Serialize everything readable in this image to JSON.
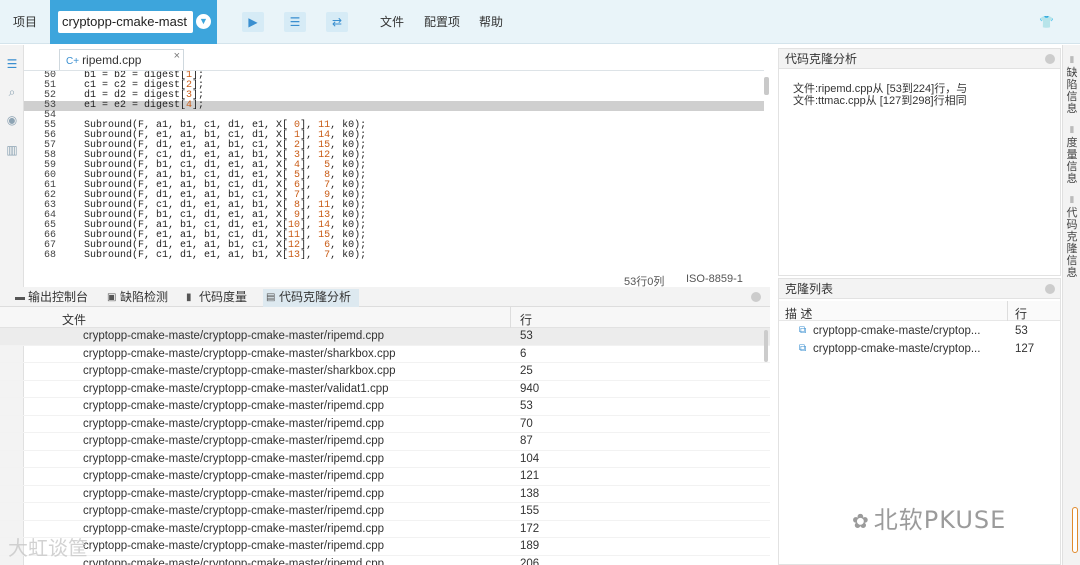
{
  "topbar": {
    "project_label": "项目",
    "project_name": "cryptopp-cmake-mast",
    "menus": [
      "文件",
      "配置项",
      "帮助"
    ]
  },
  "editor": {
    "tab_name": "ripemd.cpp",
    "highlight_line": 53,
    "lines": [
      {
        "n": "50",
        "code": "    b1 = b2 = digest[1];"
      },
      {
        "n": "51",
        "code": "    c1 = c2 = digest[2];"
      },
      {
        "n": "52",
        "code": "    d1 = d2 = digest[3];"
      },
      {
        "n": "53",
        "code": "    e1 = e2 = digest[4];"
      },
      {
        "n": "54",
        "code": ""
      },
      {
        "n": "55",
        "code": "    Subround(F, a1, b1, c1, d1, e1, X[ 0], 11, k0);"
      },
      {
        "n": "56",
        "code": "    Subround(F, e1, a1, b1, c1, d1, X[ 1], 14, k0);"
      },
      {
        "n": "57",
        "code": "    Subround(F, d1, e1, a1, b1, c1, X[ 2], 15, k0);"
      },
      {
        "n": "58",
        "code": "    Subround(F, c1, d1, e1, a1, b1, X[ 3], 12, k0);"
      },
      {
        "n": "59",
        "code": "    Subround(F, b1, c1, d1, e1, a1, X[ 4],  5, k0);"
      },
      {
        "n": "60",
        "code": "    Subround(F, a1, b1, c1, d1, e1, X[ 5],  8, k0);"
      },
      {
        "n": "61",
        "code": "    Subround(F, e1, a1, b1, c1, d1, X[ 6],  7, k0);"
      },
      {
        "n": "62",
        "code": "    Subround(F, d1, e1, a1, b1, c1, X[ 7],  9, k0);"
      },
      {
        "n": "63",
        "code": "    Subround(F, c1, d1, e1, a1, b1, X[ 8], 11, k0);"
      },
      {
        "n": "64",
        "code": "    Subround(F, b1, c1, d1, e1, a1, X[ 9], 13, k0);"
      },
      {
        "n": "65",
        "code": "    Subround(F, a1, b1, c1, d1, e1, X[10], 14, k0);"
      },
      {
        "n": "66",
        "code": "    Subround(F, e1, a1, b1, c1, d1, X[11], 15, k0);"
      },
      {
        "n": "67",
        "code": "    Subround(F, d1, e1, a1, b1, c1, X[12],  6, k0);"
      },
      {
        "n": "68",
        "code": "    Subround(F, c1, d1, e1, a1, b1, X[13],  7, k0);"
      }
    ],
    "status_position": "53行0列",
    "status_encoding": "ISO-8859-1"
  },
  "bottom_tabs": [
    "输出控制台",
    "缺陷检测",
    "代码度量",
    "代码克隆分析"
  ],
  "file_table": {
    "headers": [
      "文件",
      "行"
    ],
    "rows": [
      {
        "file": "cryptopp-cmake-maste/cryptopp-cmake-master/ripemd.cpp",
        "line": "53"
      },
      {
        "file": "cryptopp-cmake-maste/cryptopp-cmake-master/sharkbox.cpp",
        "line": "6"
      },
      {
        "file": "cryptopp-cmake-maste/cryptopp-cmake-master/sharkbox.cpp",
        "line": "25"
      },
      {
        "file": "cryptopp-cmake-maste/cryptopp-cmake-master/validat1.cpp",
        "line": "940"
      },
      {
        "file": "cryptopp-cmake-maste/cryptopp-cmake-master/ripemd.cpp",
        "line": "53"
      },
      {
        "file": "cryptopp-cmake-maste/cryptopp-cmake-master/ripemd.cpp",
        "line": "70"
      },
      {
        "file": "cryptopp-cmake-maste/cryptopp-cmake-master/ripemd.cpp",
        "line": "87"
      },
      {
        "file": "cryptopp-cmake-maste/cryptopp-cmake-master/ripemd.cpp",
        "line": "104"
      },
      {
        "file": "cryptopp-cmake-maste/cryptopp-cmake-master/ripemd.cpp",
        "line": "121"
      },
      {
        "file": "cryptopp-cmake-maste/cryptopp-cmake-master/ripemd.cpp",
        "line": "138"
      },
      {
        "file": "cryptopp-cmake-maste/cryptopp-cmake-master/ripemd.cpp",
        "line": "155"
      },
      {
        "file": "cryptopp-cmake-maste/cryptopp-cmake-master/ripemd.cpp",
        "line": "172"
      },
      {
        "file": "cryptopp-cmake-maste/cryptopp-cmake-master/ripemd.cpp",
        "line": "189"
      },
      {
        "file": "cryptopp-cmake-maste/cryptopp-cmake-master/ripemd.cpp",
        "line": "206"
      }
    ]
  },
  "clone_analysis": {
    "title": "代码克隆分析",
    "line1": "文件:ripemd.cpp从 [53到224]行，与",
    "line2": "文件:ttmac.cpp从 [127到298]行相同"
  },
  "clone_list": {
    "title": "克隆列表",
    "headers": [
      "描 述",
      "行"
    ],
    "rows": [
      {
        "desc": "cryptopp-cmake-maste/cryptop...",
        "line": "53"
      },
      {
        "desc": "cryptopp-cmake-maste/cryptop...",
        "line": "127"
      }
    ]
  },
  "right_tabs": [
    "缺陷信息",
    "度量信息",
    "代码克隆信息"
  ],
  "watermark_right": "北软PKUSE",
  "watermark_left": "大虹谈筐"
}
